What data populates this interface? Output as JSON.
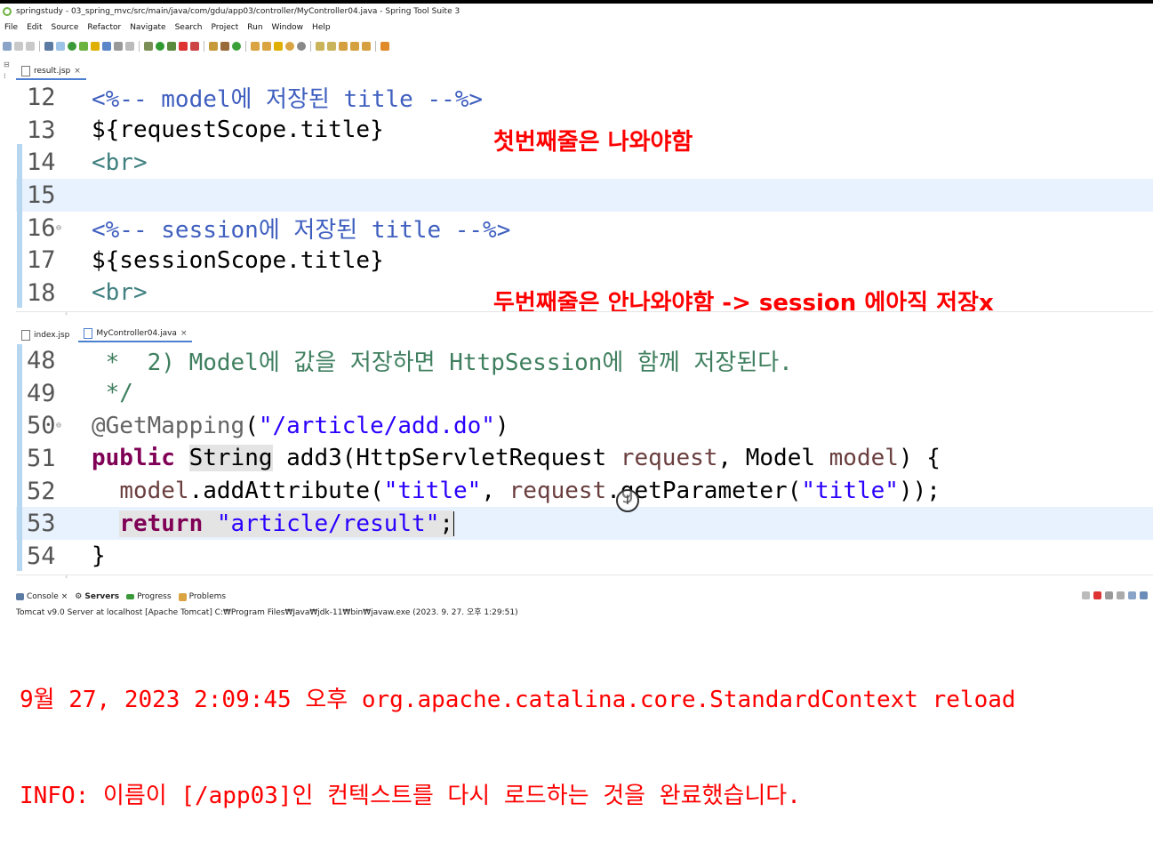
{
  "window": {
    "title": "springstudy - 03_spring_mvc/src/main/java/com/gdu/app03/controller/MyController04.java - Spring Tool Suite 3"
  },
  "menu": [
    "File",
    "Edit",
    "Source",
    "Refactor",
    "Navigate",
    "Search",
    "Project",
    "Run",
    "Window",
    "Help"
  ],
  "top_editor": {
    "tabs": [
      {
        "label": "result.jsp",
        "close": "×"
      }
    ],
    "lines": [
      {
        "num": "12",
        "parts": [
          {
            "t": "<%-- model에 저장된 title --%>",
            "c": "cm"
          }
        ]
      },
      {
        "num": "13",
        "parts": [
          {
            "t": "${requestScope.title}",
            "c": ""
          }
        ]
      },
      {
        "num": "14",
        "parts": [
          {
            "t": "<br>",
            "c": "tag"
          }
        ]
      },
      {
        "num": "15",
        "parts": []
      },
      {
        "num": "16",
        "parts": [
          {
            "t": "<%-- session에 저장된 title --%>",
            "c": "cm"
          }
        ]
      },
      {
        "num": "17",
        "parts": [
          {
            "t": "${sessionScope.title}",
            "c": ""
          }
        ]
      },
      {
        "num": "18",
        "parts": [
          {
            "t": "<br>",
            "c": "tag"
          }
        ]
      }
    ],
    "note1": "첫번째줄은 나와야함",
    "note2": "두번째줄은 안나와야함 -> session 에아직 저장x"
  },
  "bottom_editor": {
    "tabs": [
      {
        "label": "index.jsp",
        "close": ""
      },
      {
        "label": "MyController04.java",
        "close": "×"
      }
    ],
    "lines": [
      {
        "num": "48",
        "parts": [
          {
            "t": " *  2) Model에 값을 저장하면 HttpSession에 함께 저장된다.",
            "c": "green"
          }
        ]
      },
      {
        "num": "49",
        "parts": [
          {
            "t": " */",
            "c": "green"
          }
        ]
      },
      {
        "num": "50",
        "parts": [
          {
            "t": "@GetMapping",
            "c": "ann"
          },
          {
            "t": "(",
            "c": ""
          },
          {
            "t": "\"/article/add.do\"",
            "c": "str"
          },
          {
            "t": ")",
            "c": ""
          }
        ]
      },
      {
        "num": "51",
        "parts": [
          {
            "t": "public",
            "c": "kw"
          },
          {
            "t": " ",
            "c": ""
          },
          {
            "t": "String",
            "c": "grayhl"
          },
          {
            "t": " add3(HttpServletRequest ",
            "c": ""
          },
          {
            "t": "request",
            "c": "var"
          },
          {
            "t": ", Model ",
            "c": ""
          },
          {
            "t": "model",
            "c": "var"
          },
          {
            "t": ") {",
            "c": ""
          }
        ]
      },
      {
        "num": "52",
        "parts": [
          {
            "t": "  ",
            "c": ""
          },
          {
            "t": "model",
            "c": "var"
          },
          {
            "t": ".addAttribute(",
            "c": ""
          },
          {
            "t": "\"title\"",
            "c": "str"
          },
          {
            "t": ", ",
            "c": ""
          },
          {
            "t": "request",
            "c": "var"
          },
          {
            "t": ".getParameter(",
            "c": ""
          },
          {
            "t": "\"title\"",
            "c": "str"
          },
          {
            "t": "));",
            "c": ""
          }
        ]
      },
      {
        "num": "53",
        "parts": [
          {
            "t": "  ",
            "c": ""
          },
          {
            "t": "return",
            "c": "kw grayhl"
          },
          {
            "t": " ",
            "c": "grayhl"
          },
          {
            "t": "\"article/result\"",
            "c": "str grayhl"
          },
          {
            "t": ";",
            "c": "grayhl"
          }
        ]
      },
      {
        "num": "54",
        "parts": [
          {
            "t": "}",
            "c": ""
          }
        ]
      }
    ]
  },
  "console": {
    "tabs": [
      "Console",
      "Servers",
      "Progress",
      "Problems"
    ],
    "info": "Tomcat v9.0 Server at localhost [Apache Tomcat] C:₩Program Files₩Java₩jdk-11₩bin₩javaw.exe  (2023. 9. 27. 오후 1:29:51)",
    "lines": [
      "9월 27, 2023 2:09:45 오후 org.apache.catalina.core.StandardContext reload",
      "INFO: 이름이 [/app03]인 컨텍스트를 다시 로드하는 것을 완료했습니다."
    ]
  },
  "colors": {
    "note": "#ff0000",
    "comment": "#3f5fbf",
    "keyword": "#7f0055",
    "string": "#2a00ff",
    "line_highlight": "#e8f2fe"
  }
}
